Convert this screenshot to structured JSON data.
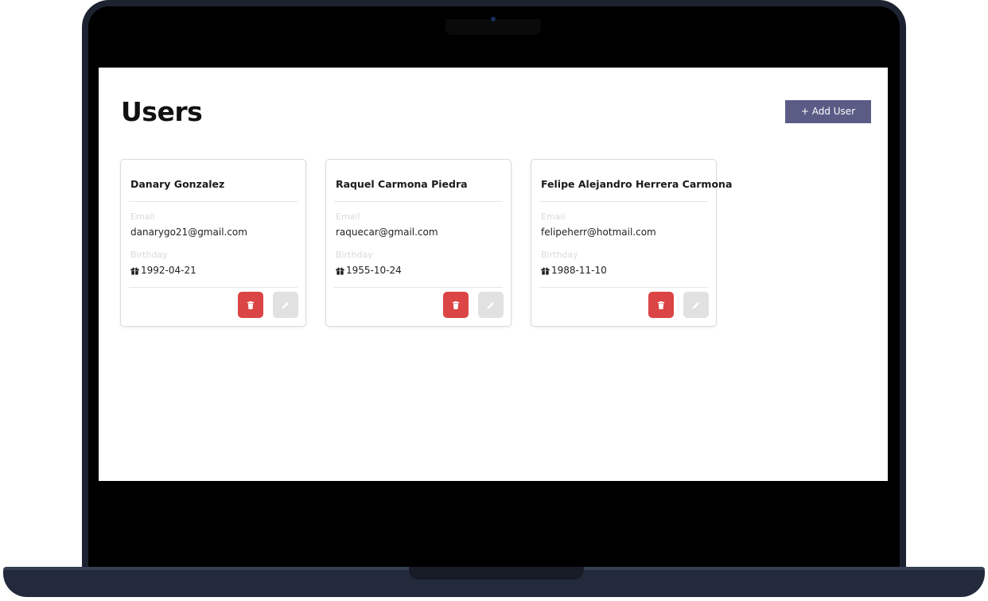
{
  "page": {
    "title": "Users",
    "add_button_label": "+ Add User"
  },
  "users": [
    {
      "name": "Danary Gonzalez",
      "email_label": "Email",
      "email": "danarygo21@gmail.com",
      "birthday_label": "Birthday",
      "birthday": "1992-04-21"
    },
    {
      "name": "Raquel Carmona Piedra",
      "email_label": "Email",
      "email": "raquecar@gmail.com",
      "birthday_label": "Birthday",
      "birthday": "1955-10-24"
    },
    {
      "name": "Felipe Alejandro Herrera Carmona",
      "email_label": "Email",
      "email": "felipeherr@hotmail.com",
      "birthday_label": "Birthday",
      "birthday": "1988-11-10"
    }
  ],
  "icons": {
    "birthday": "gift-icon",
    "delete": "trash-icon",
    "edit": "pencil-icon"
  },
  "colors": {
    "accent": "#5a5c86",
    "danger": "#db4545",
    "neutral_button": "#e1e1e1"
  }
}
